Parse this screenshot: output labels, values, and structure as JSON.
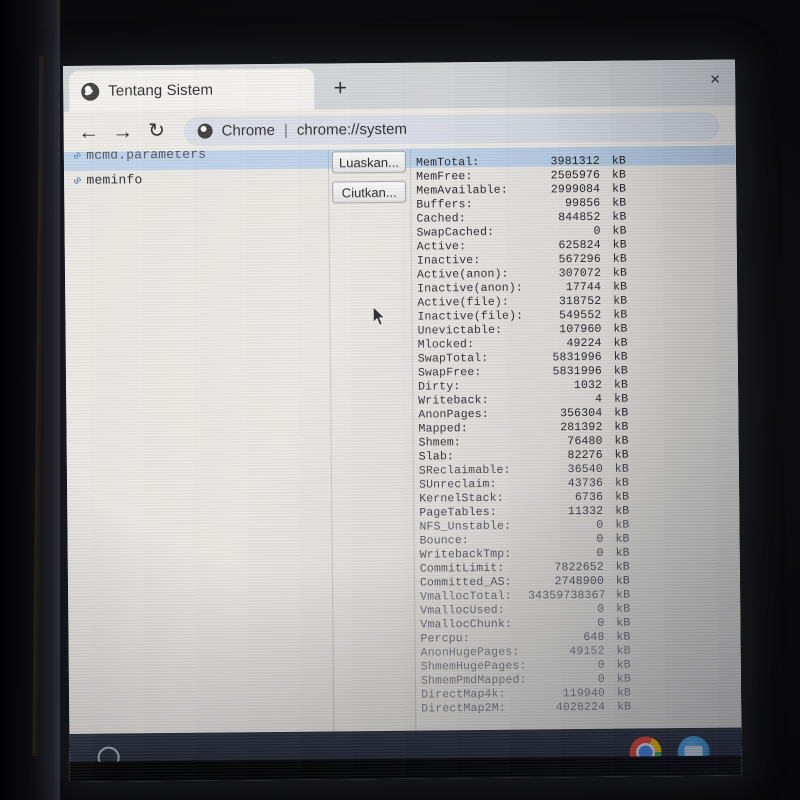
{
  "window": {
    "os": "ChromeOS",
    "page_title": "Tentang Sistem"
  },
  "tabstrip": {
    "tab_title": "Tentang Sistem",
    "close_label": "×",
    "newtab_label": "+",
    "favicon_name": "chrome-system-favicon"
  },
  "toolbar": {
    "back_label": "←",
    "forward_label": "→",
    "reload_label": "↻",
    "omnibox": {
      "chip": "Chrome",
      "separator": "|",
      "url": "chrome://system"
    }
  },
  "page": {
    "links": [
      {
        "label": "mcmd.parameters",
        "selected": true,
        "clipped": true
      },
      {
        "label": "meminfo",
        "selected": false,
        "clipped": false
      }
    ],
    "buttons": [
      {
        "label": "Luaskan...",
        "name": "expand-button"
      },
      {
        "label": "Ciutkan...",
        "name": "collapse-button"
      }
    ],
    "meminfo_unit": "kB",
    "meminfo": [
      {
        "key": "MemTotal:",
        "value": "3981312",
        "fade": 0
      },
      {
        "key": "MemFree:",
        "value": "2505976",
        "fade": 0
      },
      {
        "key": "MemAvailable:",
        "value": "2999084",
        "fade": 0
      },
      {
        "key": "Buffers:",
        "value": "99856",
        "fade": 0
      },
      {
        "key": "Cached:",
        "value": "844852",
        "fade": 0
      },
      {
        "key": "SwapCached:",
        "value": "0",
        "fade": 0
      },
      {
        "key": "Active:",
        "value": "625824",
        "fade": 0
      },
      {
        "key": "Inactive:",
        "value": "567296",
        "fade": 0
      },
      {
        "key": "Active(anon):",
        "value": "307072",
        "fade": 0
      },
      {
        "key": "Inactive(anon):",
        "value": "17744",
        "fade": 0
      },
      {
        "key": "Active(file):",
        "value": "318752",
        "fade": 0
      },
      {
        "key": "Inactive(file):",
        "value": "549552",
        "fade": 0
      },
      {
        "key": "Unevictable:",
        "value": "107960",
        "fade": 0
      },
      {
        "key": "Mlocked:",
        "value": "49224",
        "fade": 0
      },
      {
        "key": "SwapTotal:",
        "value": "5831996",
        "fade": 0
      },
      {
        "key": "SwapFree:",
        "value": "5831996",
        "fade": 0
      },
      {
        "key": "Dirty:",
        "value": "1032",
        "fade": 0
      },
      {
        "key": "Writeback:",
        "value": "4",
        "fade": 0
      },
      {
        "key": "AnonPages:",
        "value": "356304",
        "fade": 0
      },
      {
        "key": "Mapped:",
        "value": "281392",
        "fade": 0
      },
      {
        "key": "Shmem:",
        "value": "76480",
        "fade": 0
      },
      {
        "key": "Slab:",
        "value": "82276",
        "fade": 0
      },
      {
        "key": "SReclaimable:",
        "value": "36540",
        "fade": 1
      },
      {
        "key": "SUnreclaim:",
        "value": "43736",
        "fade": 1
      },
      {
        "key": "KernelStack:",
        "value": "6736",
        "fade": 1
      },
      {
        "key": "PageTables:",
        "value": "11332",
        "fade": 1
      },
      {
        "key": "NFS_Unstable:",
        "value": "0",
        "fade": 2
      },
      {
        "key": "Bounce:",
        "value": "0",
        "fade": 2
      },
      {
        "key": "WritebackTmp:",
        "value": "0",
        "fade": 2
      },
      {
        "key": "CommitLimit:",
        "value": "7822652",
        "fade": 2
      },
      {
        "key": "Committed_AS:",
        "value": "2748900",
        "fade": 2
      },
      {
        "key": "VmallocTotal:",
        "value": "34359738367",
        "fade": 3
      },
      {
        "key": "VmallocUsed:",
        "value": "0",
        "fade": 3
      },
      {
        "key": "VmallocChunk:",
        "value": "0",
        "fade": 3
      },
      {
        "key": "Percpu:",
        "value": "648",
        "fade": 3
      },
      {
        "key": "AnonHugePages:",
        "value": "49152",
        "fade": 4
      },
      {
        "key": "ShmemHugePages:",
        "value": "0",
        "fade": 4
      },
      {
        "key": "ShmemPmdMapped:",
        "value": "0",
        "fade": 4
      },
      {
        "key": "DirectMap4k:",
        "value": "119940",
        "fade": 4
      },
      {
        "key": "DirectMap2M:",
        "value": "4028224",
        "fade": 4
      }
    ]
  },
  "shelf": {
    "launcher_name": "launcher-button",
    "apps": [
      {
        "name": "chrome-app-icon",
        "label": "Chrome"
      },
      {
        "name": "files-app-icon",
        "label": "Files"
      }
    ]
  },
  "colors": {
    "accent_blue": "#b9cfe8",
    "link_blue": "#2d5aa8",
    "shelf": "#222634",
    "page_bg": "#e9e7e2"
  }
}
